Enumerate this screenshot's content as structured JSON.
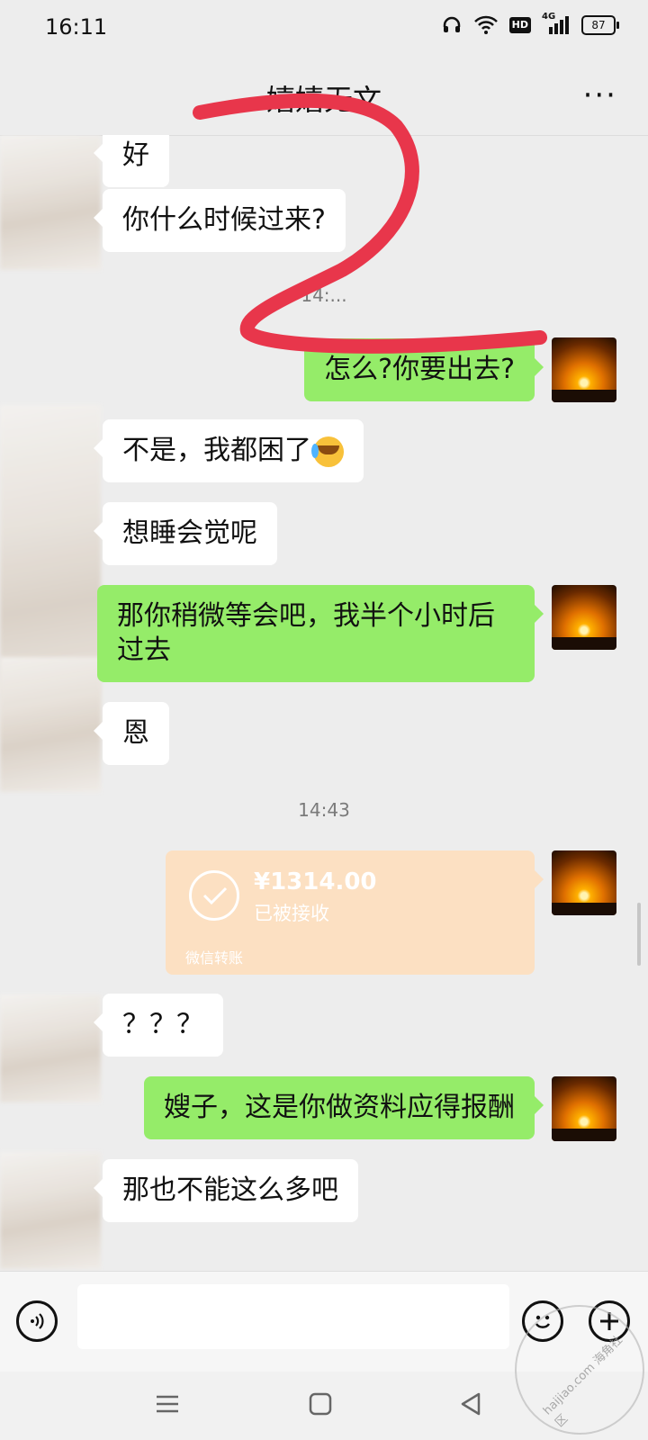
{
  "status_bar": {
    "time": "16:11",
    "hd": "HD",
    "network": "4G",
    "battery": "87"
  },
  "header": {
    "title": "嬉嬉无文",
    "more": "···"
  },
  "messages": [
    {
      "side": "in",
      "text": "好"
    },
    {
      "side": "in",
      "text": "你什么时候过来?"
    },
    {
      "type": "time",
      "text": "14:..."
    },
    {
      "side": "out",
      "text": "怎么?你要出去?"
    },
    {
      "side": "in",
      "text": "不是，我都困了"
    },
    {
      "side": "in",
      "text": "想睡会觉呢"
    },
    {
      "side": "out",
      "text": "那你稍微等会吧，我半个小时后过去"
    },
    {
      "side": "in",
      "text": "恩"
    },
    {
      "type": "time",
      "text": "14:43"
    },
    {
      "side": "in",
      "text": "？？？"
    },
    {
      "side": "out",
      "text": "嫂子，这是你做资料应得报酬"
    },
    {
      "side": "in",
      "text": "那也不能这么多吧"
    }
  ],
  "transfer": {
    "amount": "¥1314.00",
    "status": "已被接收",
    "label": "微信转账"
  },
  "input": {
    "placeholder": ""
  },
  "colors": {
    "out_bubble": "#95ec69",
    "in_bubble": "#ffffff",
    "transfer_bg": "#fce0c2",
    "scribble": "#e8364b"
  },
  "watermark": "haijiao.com 海角社区"
}
